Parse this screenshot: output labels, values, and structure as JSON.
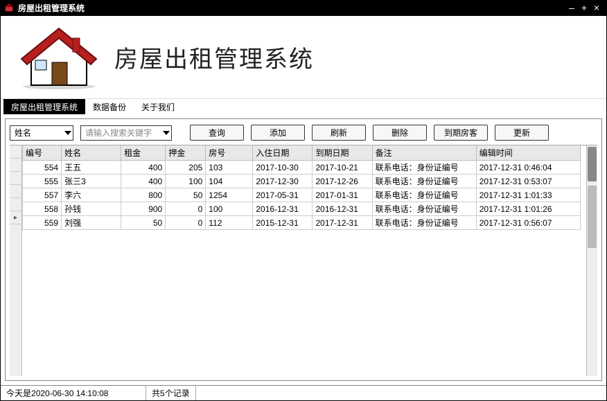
{
  "window": {
    "title": "房屋出租管理系统"
  },
  "banner": {
    "title": "房屋出租管理系统"
  },
  "tabs": {
    "t0": "房屋出租管理系统",
    "t1": "数据备份",
    "t2": "关于我们"
  },
  "search": {
    "field": "姓名",
    "placeholder": "请输入搜索关键字"
  },
  "buttons": {
    "query": "查询",
    "add": "添加",
    "refresh": "刷新",
    "delete": "删除",
    "expire": "到期房客",
    "update": "更新"
  },
  "columns": {
    "id": "编号",
    "name": "姓名",
    "rent": "租金",
    "deposit": "押金",
    "room": "房号",
    "checkin": "入住日期",
    "due": "到期日期",
    "remark": "备注",
    "edited": "编辑时间"
  },
  "rows": [
    {
      "id": "554",
      "name": "王五",
      "rent": "400",
      "deposit": "205",
      "room": "103",
      "checkin": "2017-10-30",
      "due": "2017-10-21",
      "remark": "联系电话：身份证编号",
      "edited": "2017-12-31 0:46:04"
    },
    {
      "id": "555",
      "name": "张三3",
      "rent": "400",
      "deposit": "100",
      "room": "104",
      "checkin": "2017-12-30",
      "due": "2017-12-26",
      "remark": "联系电话：身份证编号",
      "edited": "2017-12-31 0:53:07"
    },
    {
      "id": "557",
      "name": "李六",
      "rent": "800",
      "deposit": "50",
      "room": "1254",
      "checkin": "2017-05-31",
      "due": "2017-01-31",
      "remark": "联系电话：身份证编号",
      "edited": "2017-12-31 1:01:33"
    },
    {
      "id": "558",
      "name": "孙钱",
      "rent": "900",
      "deposit": "0",
      "room": "100",
      "checkin": "2016-12-31",
      "due": "2016-12-31",
      "remark": "联系电话：身份证编号",
      "edited": "2017-12-31 1:01:26"
    },
    {
      "id": "559",
      "name": "刘强",
      "rent": "50",
      "deposit": "0",
      "room": "112",
      "checkin": "2015-12-31",
      "due": "2017-12-31",
      "remark": "联系电话：身份证编号",
      "edited": "2017-12-31 0:56:07"
    }
  ],
  "row_marker": "▸",
  "status": {
    "date_prefix": "今天是",
    "date": "2020-06-30 14:10:08",
    "count_prefix": "共 ",
    "count": "5",
    "count_suffix": " 个记录"
  }
}
